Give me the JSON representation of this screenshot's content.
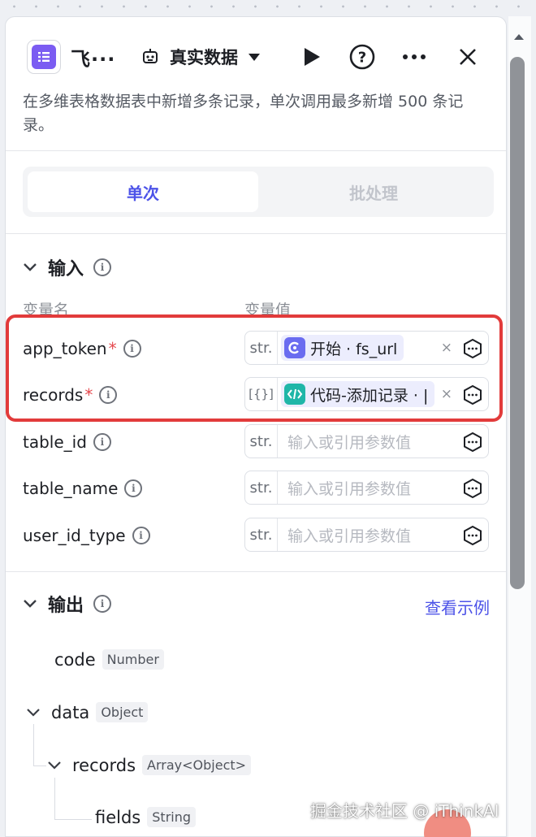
{
  "header": {
    "title": "飞···",
    "mode_label": "真实数据",
    "description": "在多维表格数据表中新增多条记录，单次调用最多新增 500 条记录。"
  },
  "tabs": [
    {
      "label": "单次",
      "active": true
    },
    {
      "label": "批处理",
      "active": false
    }
  ],
  "input": {
    "title": "输入",
    "col_name": "变量名",
    "col_value": "变量值",
    "rows": [
      {
        "name": "app_token",
        "required": "*",
        "type": "str.",
        "ref_text": "开始 · fs_url",
        "ref_icon": "start-node-icon",
        "remove": "×"
      },
      {
        "name": "records",
        "required": "*",
        "type": "[{}]",
        "ref_text": "代码-添加记录 · |",
        "ref_icon": "code-node-icon",
        "remove": "×"
      },
      {
        "name": "table_id",
        "type": "str.",
        "placeholder": "输入或引用参数值"
      },
      {
        "name": "table_name",
        "type": "str.",
        "placeholder": "输入或引用参数值"
      },
      {
        "name": "user_id_type",
        "type": "str.",
        "placeholder": "输入或引用参数值"
      }
    ]
  },
  "output": {
    "title": "输出",
    "example_link": "查看示例",
    "fields": [
      {
        "name": "code",
        "type": "Number"
      },
      {
        "name": "data",
        "type": "Object"
      },
      {
        "name": "records",
        "type": "Array<Object>"
      },
      {
        "name": "fields",
        "type": "String"
      }
    ]
  },
  "watermark": "掘金技术社区 @ iThinkAI",
  "colors": {
    "accent": "#4d53e8",
    "highlight": "#e23b3b",
    "app_icon": "#7b5cf2",
    "code_icon": "#1fb6a8"
  }
}
